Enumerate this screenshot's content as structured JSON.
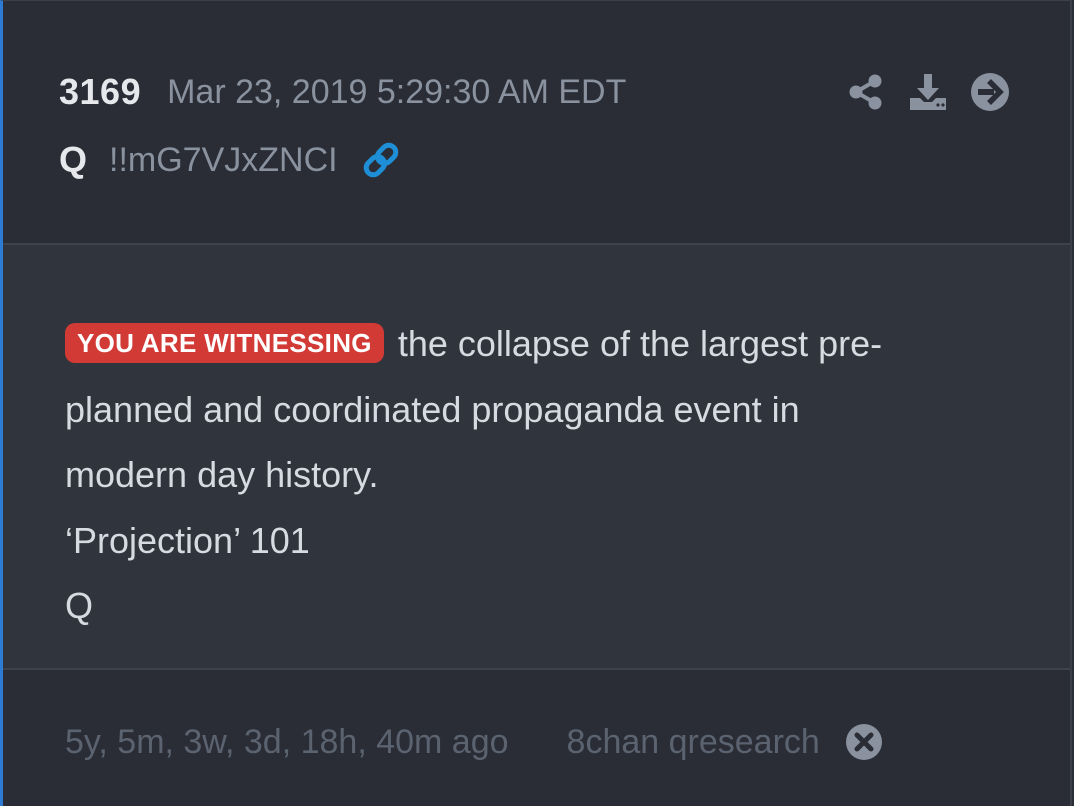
{
  "post": {
    "number": "3169",
    "date": "Mar 23, 2019 5:29:30 AM EDT",
    "author": "Q",
    "tripcode": "!!mG7VJxZNCI"
  },
  "actions": [
    "share-icon",
    "download-icon",
    "arrow-right-circle-icon"
  ],
  "message": {
    "badge": "YOU ARE WITNESSING",
    "line1_rest": "the collapse of the largest pre-",
    "line2": "planned and coordinated propaganda event in",
    "line3": "modern day history.",
    "line4": "‘Projection’ 101",
    "line5": "Q"
  },
  "footer": {
    "age": "5y, 5m, 3w, 3d, 18h, 40m ago",
    "source": "8chan qresearch"
  },
  "colors": {
    "badge": "#d23a36",
    "link": "#1e8fd6",
    "accent_border": "#2e7bd6"
  }
}
